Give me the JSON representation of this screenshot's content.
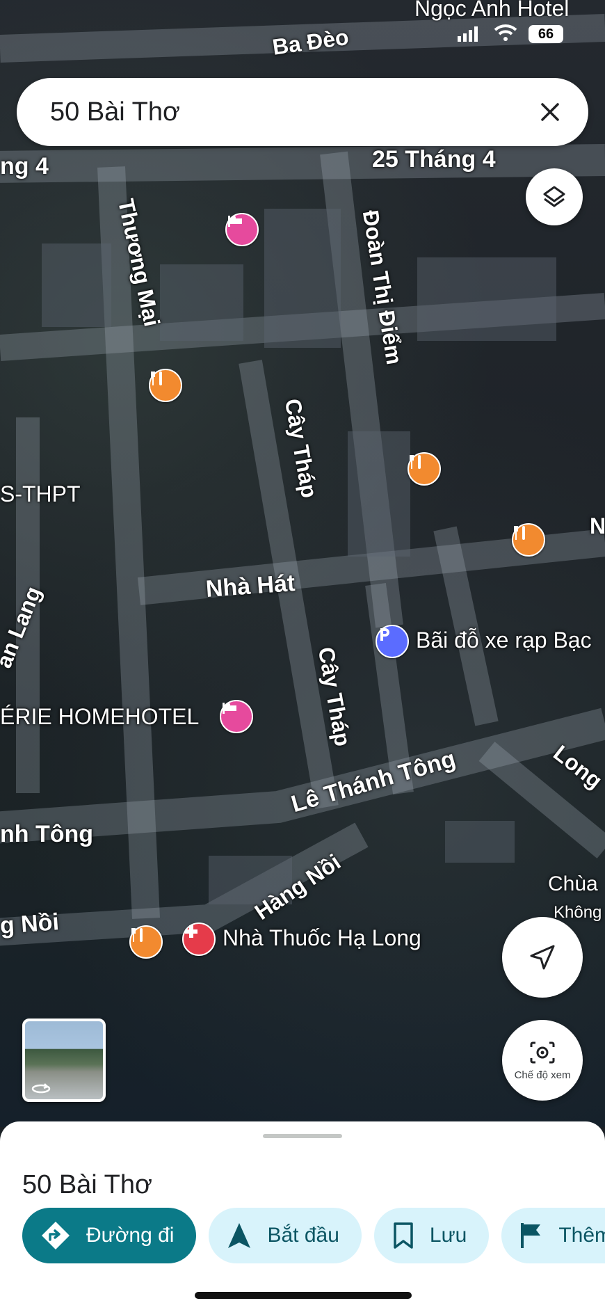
{
  "status_bar": {
    "top_right_text": "Ngọc Anh Hotel",
    "battery": "66"
  },
  "search": {
    "query": "50 Bài Thơ",
    "clear_icon": "close-icon"
  },
  "map": {
    "streets": [
      "Ba Đèo",
      "25 Tháng 4",
      "ng 4",
      "Thương Mại",
      "Đoàn Thị Điểm",
      "Cây Tháp",
      "Nhà Hát",
      "an Lang",
      "Cây Tháp",
      "Lê Thánh Tông",
      "nh Tông",
      "Hàng Nồi",
      "g Nồi",
      "Long",
      "Chùa",
      "Không",
      "N"
    ],
    "labels": {
      "school": "S-THPT",
      "hotel": "ÉRIE HOMEHOTEL",
      "parking": "Bãi đỗ xe rạp Bạc",
      "pharmacy": "Nhà Thuốc Hạ Long"
    },
    "pin_icons": [
      "hotel-icon",
      "restaurant-icon",
      "parking-icon",
      "pharmacy-icon"
    ]
  },
  "controls": {
    "layers_icon": "layers-icon",
    "locate_icon": "navigation-arrow-icon",
    "lens_label": "Chế độ xem"
  },
  "sheet": {
    "place_title": "50 Bài Thơ",
    "chips": [
      {
        "label": "Đường đi",
        "icon": "directions-icon"
      },
      {
        "label": "Bắt đầu",
        "icon": "navigation-icon"
      },
      {
        "label": "Lưu",
        "icon": "bookmark-icon"
      },
      {
        "label": "Thêm",
        "icon": "flag-icon"
      }
    ]
  },
  "colors": {
    "primary_chip": "#0b7a88",
    "secondary_chip": "#d8f3fb",
    "food_pin": "#f28a2f",
    "hotel_pin": "#e64a9d"
  }
}
